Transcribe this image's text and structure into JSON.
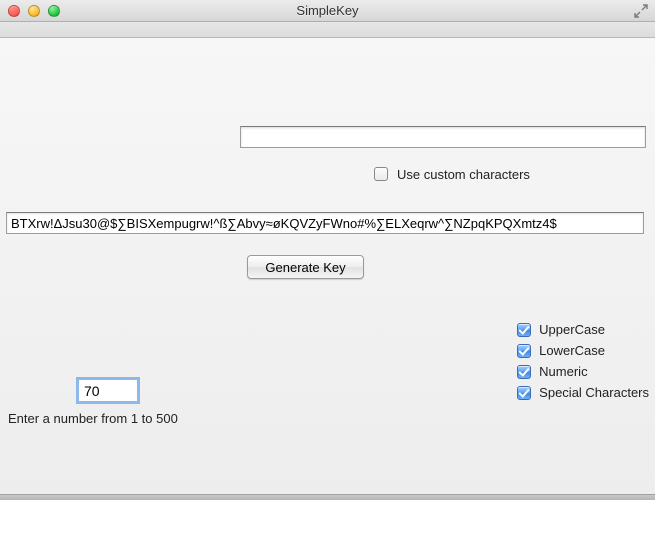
{
  "window": {
    "title": "SimpleKey"
  },
  "custom": {
    "input_value": "",
    "checkbox_label": "Use custom characters",
    "checked": false
  },
  "output": {
    "value": "BTXrw!ΔJsu30@$∑BISXempugrw!^ß∑Abvy≈øKQVZyFWno#%∑ELXeqrw^∑NZpqKPQXmtz4$"
  },
  "generate": {
    "label": "Generate Key"
  },
  "length": {
    "value": "70",
    "helper": "Enter a number from 1 to 500"
  },
  "options": {
    "uppercase": {
      "label": "UpperCase",
      "checked": true
    },
    "lowercase": {
      "label": "LowerCase",
      "checked": true
    },
    "numeric": {
      "label": "Numeric",
      "checked": true
    },
    "special": {
      "label": "Special Characters",
      "checked": true
    }
  }
}
